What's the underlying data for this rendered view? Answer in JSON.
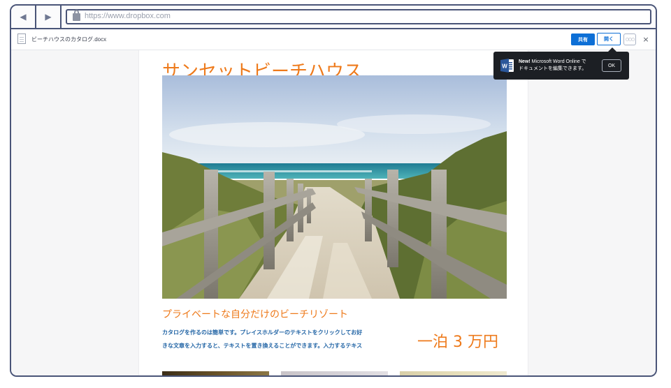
{
  "browser": {
    "url": "https://www.dropbox.com"
  },
  "preview_header": {
    "file_name": "ビーチハウスのカタログ.docx",
    "share_label": "共有",
    "open_label": "開く",
    "more_label": "○○○",
    "close_label": "×"
  },
  "tooltip": {
    "new_label": "New!",
    "line1": " Microsoft Word Online で",
    "line2": "ドキュメントを編集できます。",
    "ok_label": "OK"
  },
  "document": {
    "title": "サンセットビーチハウス",
    "subtitle": "プライベートな自分だけのビーチリゾート",
    "body_line1": "カタログを作るのは簡単です。プレイスホルダーのテキストをクリックしてお好",
    "body_line2": "きな文章を入力すると、テキストを置き換えることができます。入力するテキス",
    "price": "一泊 3 万円"
  },
  "colors": {
    "accent_orange": "#ee7a1b",
    "dropbox_blue": "#0d6fd6",
    "body_blue": "#2466a6",
    "frame": "#4a5578"
  },
  "icons": {
    "back": "chevron-left-icon",
    "forward": "chevron-right-icon",
    "lock": "lock-icon",
    "file": "document-file-icon",
    "word": "word-icon",
    "close": "close-icon"
  }
}
